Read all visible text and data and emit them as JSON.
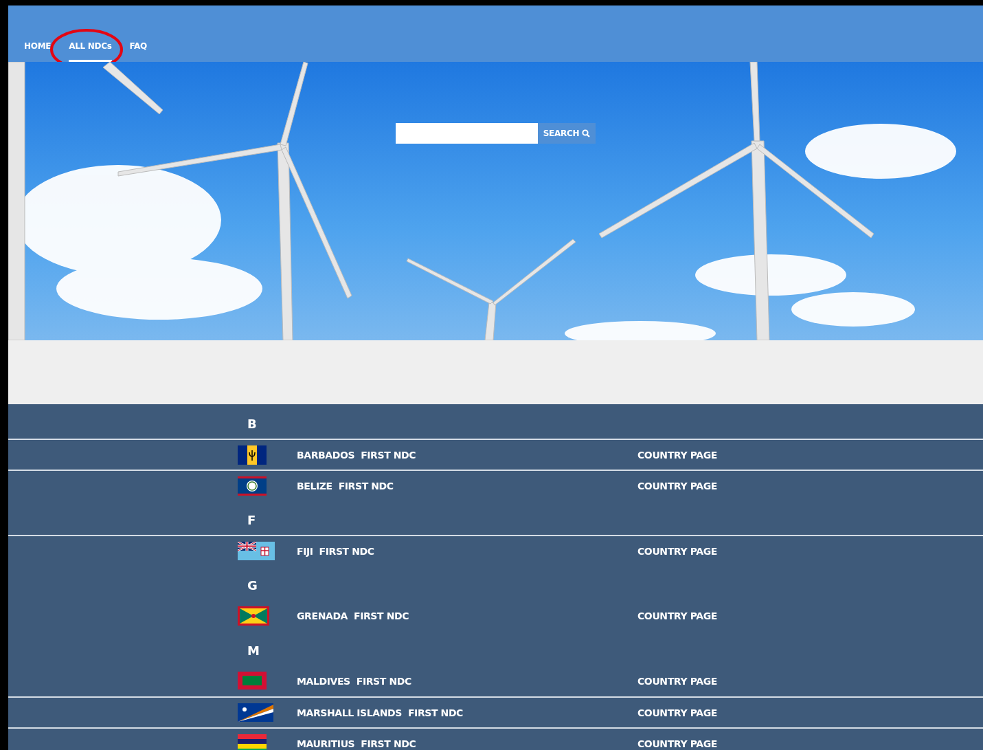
{
  "nav": {
    "items": [
      {
        "label": "HOME",
        "selected": false
      },
      {
        "label": "ALL NDCs",
        "selected": true
      },
      {
        "label": "FAQ",
        "selected": false
      }
    ],
    "highlight_ellipse": true
  },
  "search": {
    "button": "SEARCH"
  },
  "list": [
    {
      "kind": "letter",
      "label": "B"
    },
    {
      "kind": "entry",
      "flag": {
        "kind": "barbados"
      },
      "label": "BARBADOS  FIRST NDC",
      "link": "COUNTRY PAGE",
      "divider_above": true
    },
    {
      "kind": "entry",
      "flag": {
        "kind": "belize"
      },
      "label": "BELIZE  FIRST NDC",
      "link": "COUNTRY PAGE",
      "divider_above": true
    },
    {
      "kind": "letter",
      "label": "F"
    },
    {
      "kind": "entry",
      "flag": {
        "kind": "fiji"
      },
      "label": "FIJI  FIRST NDC",
      "link": "COUNTRY PAGE",
      "divider_above": true
    },
    {
      "kind": "letter",
      "label": "G"
    },
    {
      "kind": "entry",
      "flag": {
        "kind": "grenada"
      },
      "label": "GRENADA  FIRST NDC",
      "link": "COUNTRY PAGE",
      "divider_above": false
    },
    {
      "kind": "letter",
      "label": "M"
    },
    {
      "kind": "entry",
      "flag": {
        "kind": "maldives"
      },
      "label": "MALDIVES  FIRST NDC",
      "link": "COUNTRY PAGE",
      "divider_above": false
    },
    {
      "kind": "entry",
      "flag": {
        "kind": "marshall-islands"
      },
      "label": "MARSHALL ISLANDS  FIRST NDC",
      "link": "COUNTRY PAGE",
      "divider_above": true
    },
    {
      "kind": "entry",
      "flag": {
        "kind": "mauritius"
      },
      "label": "MAURITIUS  FIRST NDC",
      "link": "COUNTRY PAGE",
      "divider_above": true
    }
  ]
}
